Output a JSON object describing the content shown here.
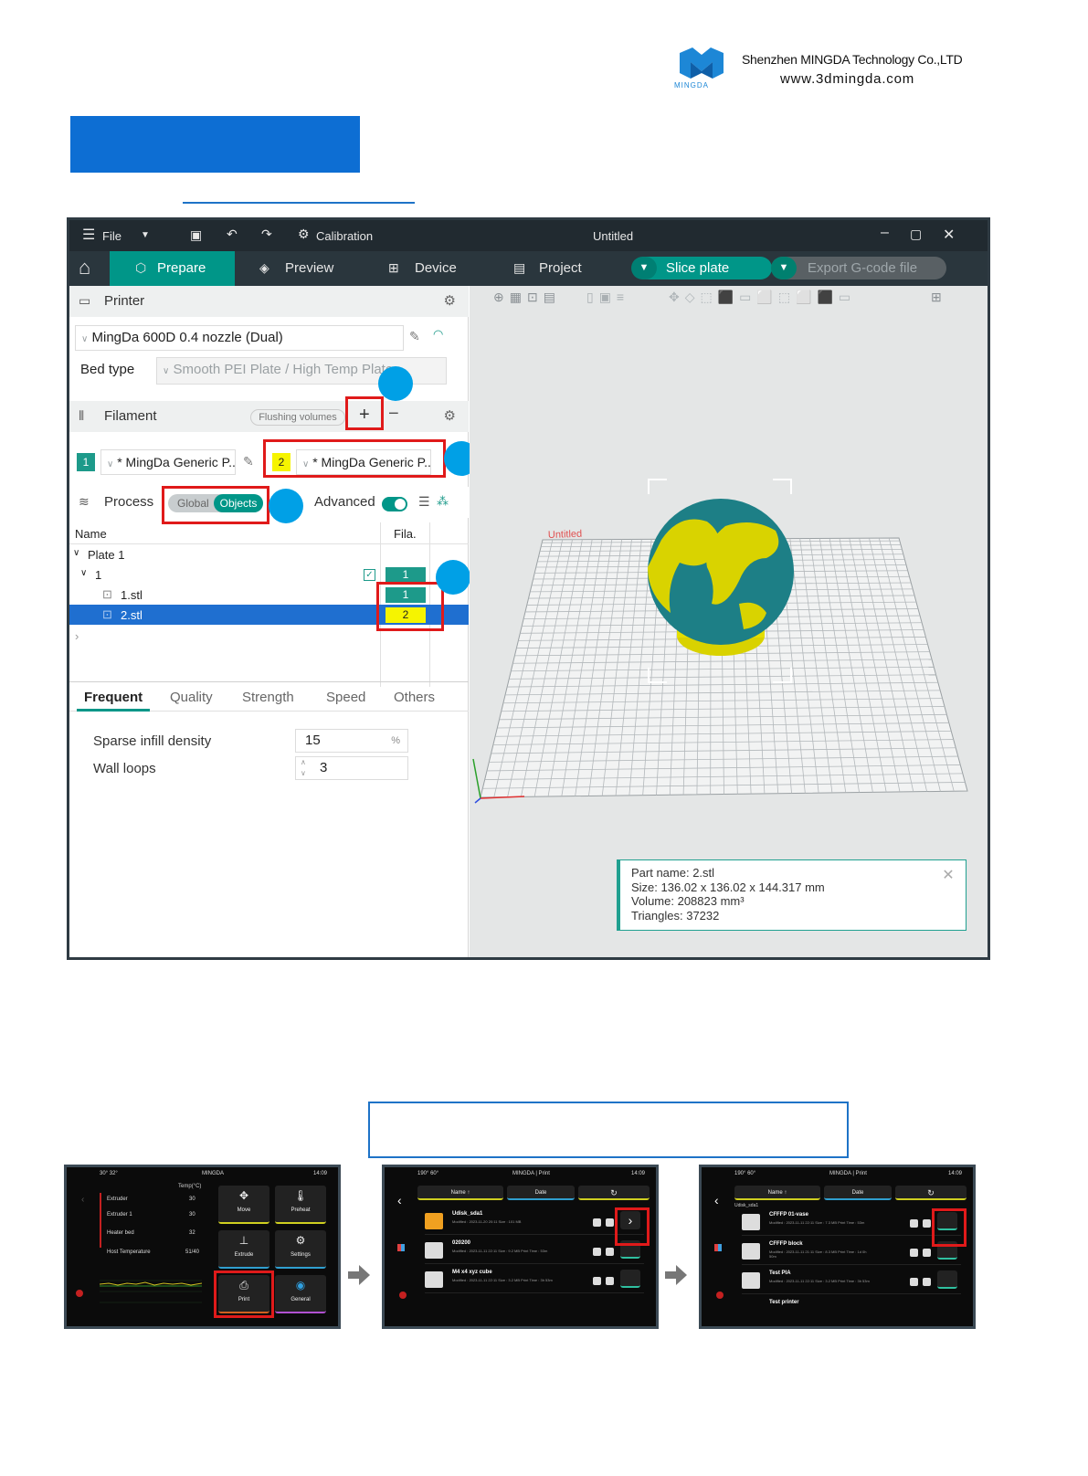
{
  "header": {
    "company": "Shenzhen MINGDA Technology Co.,LTD",
    "website": "www.3dmingda.com",
    "logo_text": "MINGDA"
  },
  "app": {
    "title_bar": {
      "file": "File",
      "calibration": "Calibration",
      "title": "Untitled"
    },
    "tabs": {
      "prepare": "Prepare",
      "preview": "Preview",
      "device": "Device",
      "project": "Project",
      "slice": "Slice plate",
      "export": "Export G-code file"
    },
    "printer": {
      "section": "Printer",
      "preset": "MingDa 600D 0.4 nozzle (Dual)",
      "bed_label": "Bed type",
      "bed_value": "Smooth PEI Plate / High Temp Plate"
    },
    "filament": {
      "section": "Filament",
      "flushing": "Flushing volumes",
      "slots": [
        {
          "num": "1",
          "name": "* MingDa Generic P..."
        },
        {
          "num": "2",
          "name": "* MingDa Generic P..."
        }
      ]
    },
    "process": {
      "section": "Process",
      "global": "Global",
      "objects": "Objects",
      "advanced": "Advanced"
    },
    "object_list": {
      "col_name": "Name",
      "col_fila": "Fila.",
      "plate": "Plate 1",
      "group": "1",
      "group_fila": "1",
      "item1": "1.stl",
      "item1_fila": "1",
      "item2": "2.stl",
      "item2_fila": "2"
    },
    "settings_tabs": [
      "Frequent",
      "Quality",
      "Strength",
      "Speed",
      "Others"
    ],
    "settings": {
      "infill_label": "Sparse infill density",
      "infill_value": "15",
      "infill_unit": "%",
      "wall_label": "Wall loops",
      "wall_value": "3"
    },
    "viewport_label": "Untitled",
    "info": {
      "line1": "Part name: 2.stl",
      "line2": "Size: 136.02 x 136.02 x 144.317 mm",
      "line3": "Volume: 208823 mm³",
      "line4": "Triangles: 37232"
    }
  },
  "screens": {
    "s1": {
      "temps": "30°   32°",
      "brand": "MINGDA",
      "time": "14:09",
      "temp_head": "Temp(°C)",
      "rows": [
        {
          "label": "Extruder",
          "value": "30"
        },
        {
          "label": "Extruder 1",
          "value": "30"
        },
        {
          "label": "Heater bed",
          "value": "32"
        },
        {
          "label": "Host Temperature",
          "value": "51/40"
        }
      ],
      "buttons": [
        "Move",
        "Preheat",
        "Extrude",
        "Settings",
        "Print",
        "General"
      ]
    },
    "s2": {
      "temps": "190°   60°",
      "brand": "MINGDA | Print",
      "time": "14:09",
      "sort": [
        "Name",
        "Date"
      ],
      "files": [
        {
          "name": "Udisk_sda1",
          "meta": "Modified : 2023-11-20 20:11  Size : 101 MB"
        },
        {
          "name": "020200",
          "meta": "Modified : 2023-11-11 22:11  Size : 9.2 MB  Print Time : 53m"
        },
        {
          "name": "M4 x4 xyz cube",
          "meta": "Modified : 2023-11-11 22:11  Size : 3.2 MB  Print Time : 3h 53m"
        }
      ]
    },
    "s3": {
      "temps": "190°   60°",
      "brand": "MINGDA | Print",
      "time": "14:09",
      "sort": [
        "Name",
        "Date"
      ],
      "path": "Udisk_sda1",
      "files": [
        {
          "name": "CFFFP 01-vase",
          "meta": "Modified : 2023-11-11 22:11  Size : 7.3 MB  Print Time : 53m"
        },
        {
          "name": "CFFFP block",
          "meta": "Modified : 2023-11-11 21:11  Size : 8.3 MB  Print Time : 1d 0h 50m"
        },
        {
          "name": "Test PIA",
          "meta": "Modified : 2023-11-11 22:11  Size : 3.2 MB  Print Time : 3h 53m"
        },
        {
          "name": "Test printer",
          "meta": ""
        }
      ]
    }
  }
}
